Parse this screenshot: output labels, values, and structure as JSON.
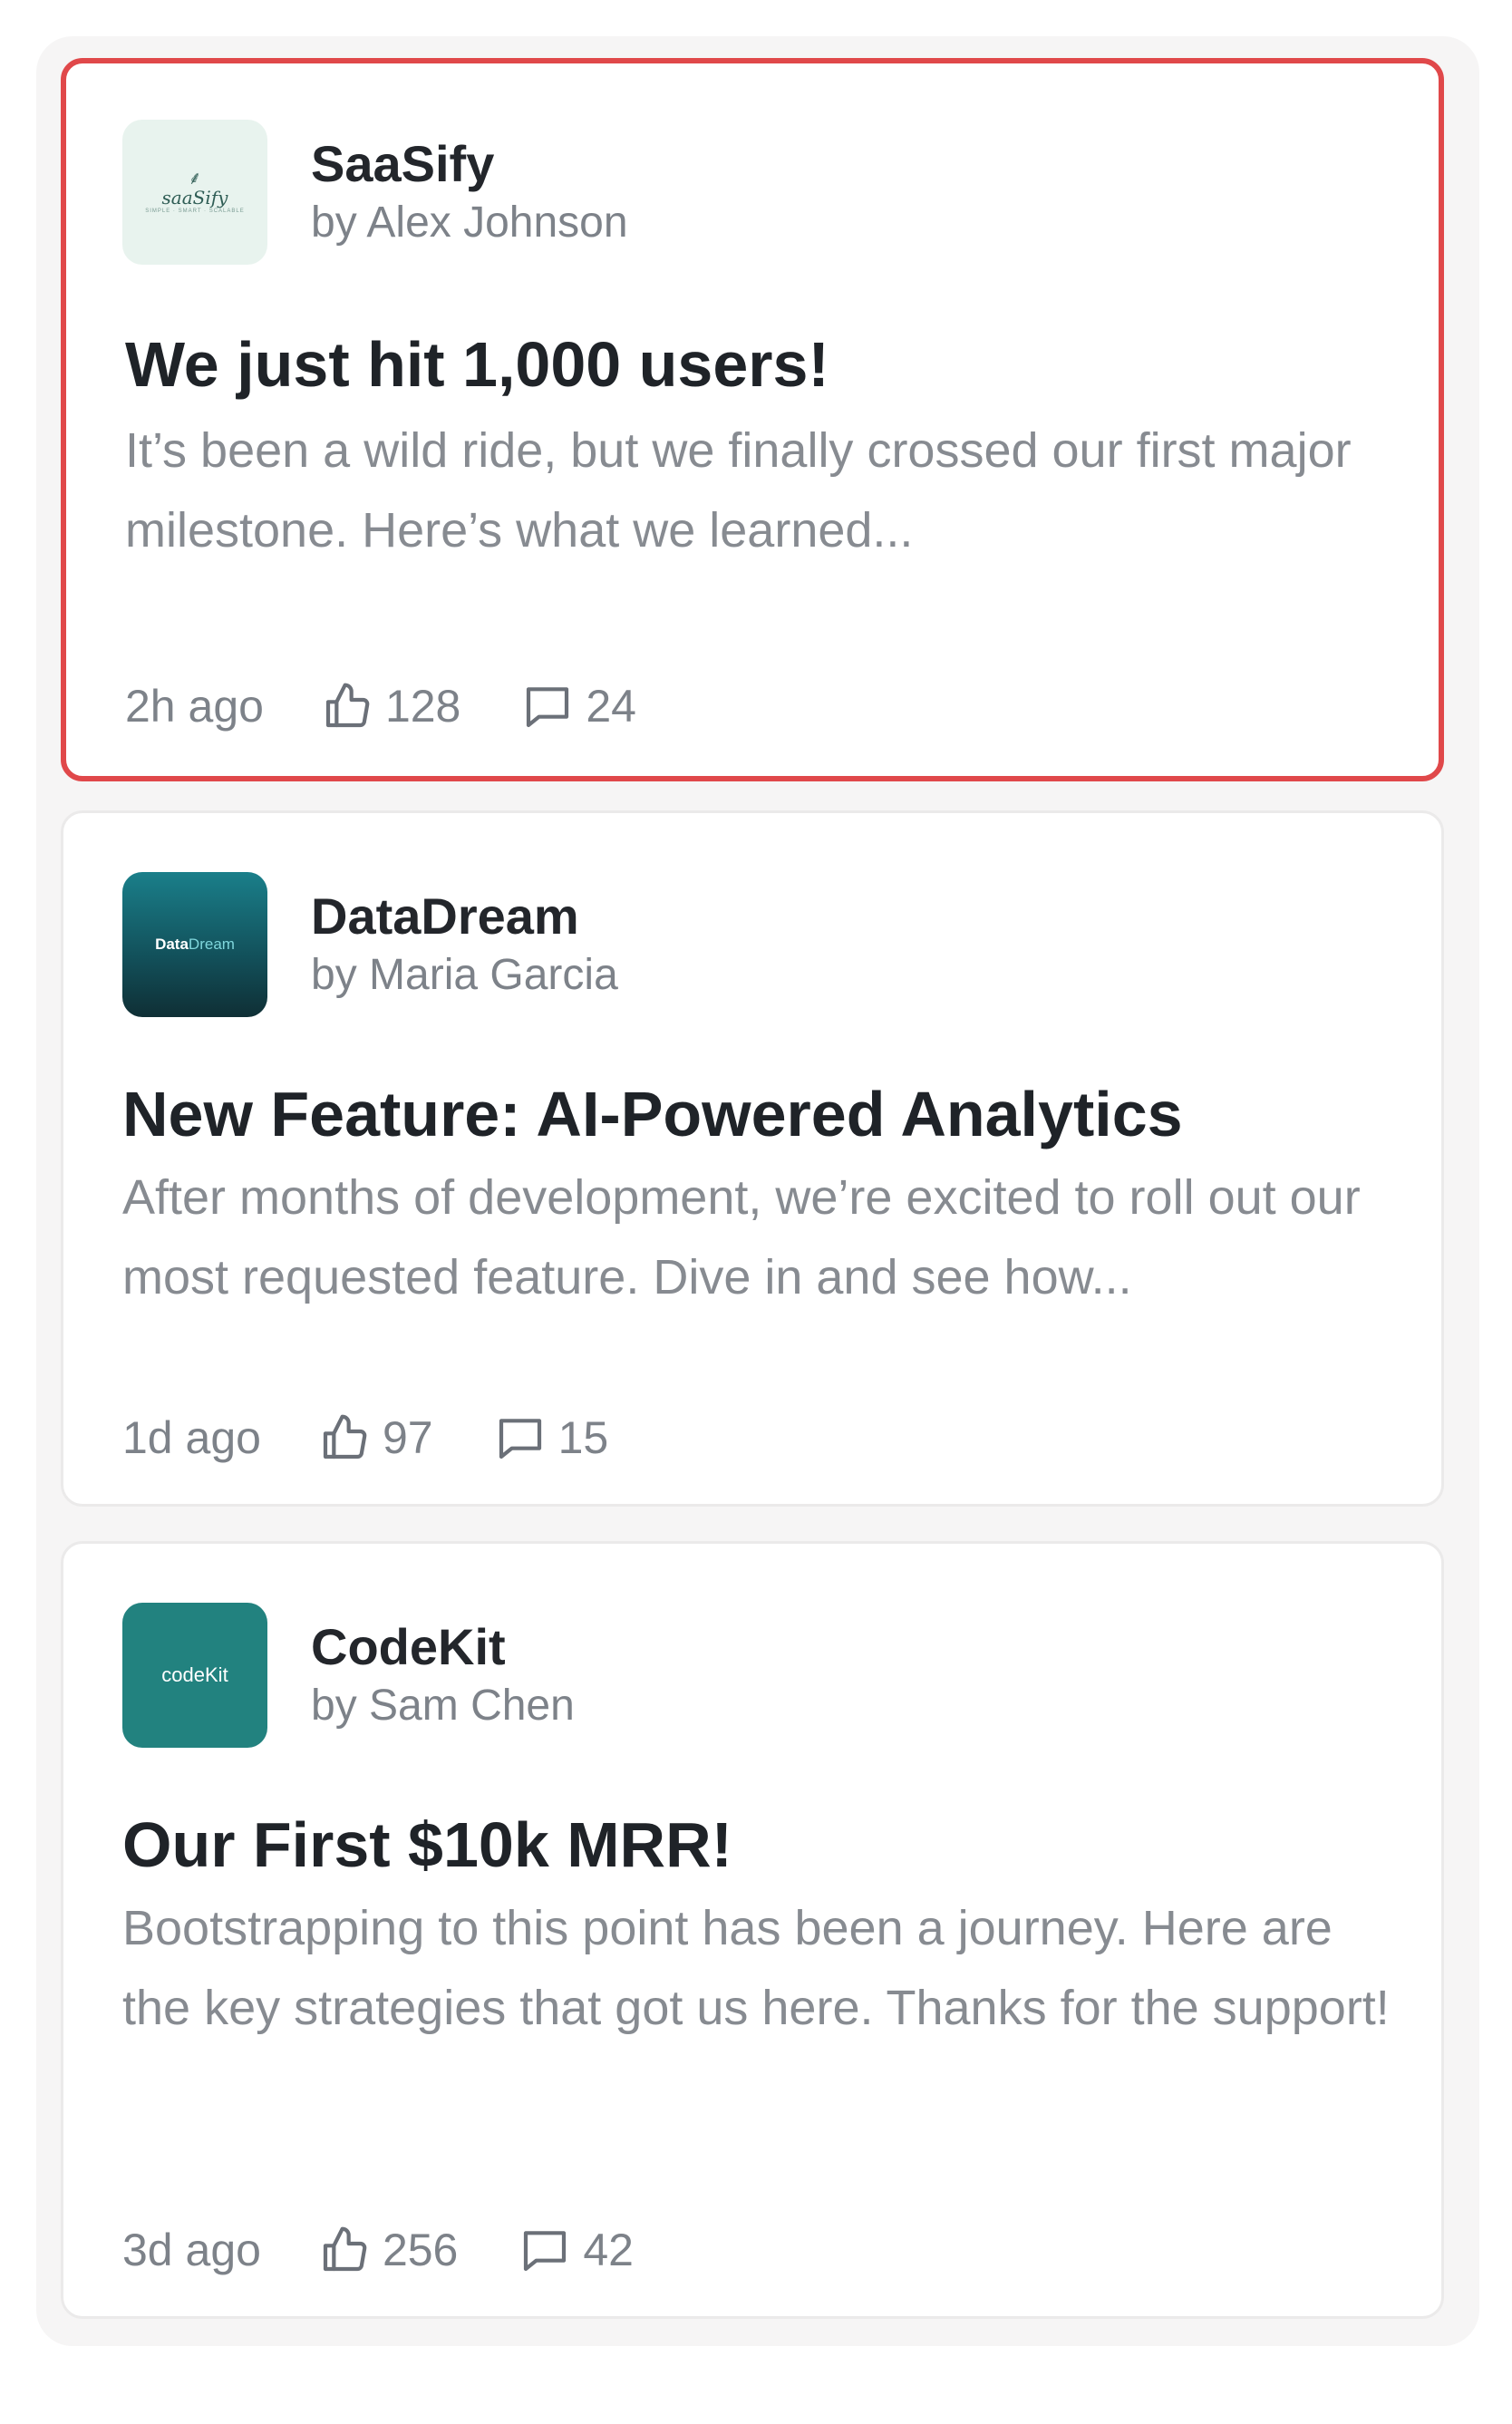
{
  "posts": [
    {
      "company": "SaaSify",
      "author": "by Alex Johnson",
      "logo": {
        "text": "saaSify",
        "tagline": "SIMPLE · SMART · SCALABLE",
        "bg": "#e8f3ee"
      },
      "title": "We just hit 1,000 users!",
      "excerpt": "It’s been a wild ride, but we finally crossed our first major milestone. Here’s what we learned...",
      "time": "2h ago",
      "likes": "128",
      "comments": "24",
      "selected": true
    },
    {
      "company": "DataDream",
      "author": "by Maria Garcia",
      "logo": {
        "text_part1": "Data",
        "text_part2": "Dream"
      },
      "title": "New Feature: AI-Powered Analytics",
      "excerpt": "After months of development, we’re excited to roll out our most requested feature. Dive in and see how...",
      "time": "1d ago",
      "likes": "97",
      "comments": "15",
      "selected": false
    },
    {
      "company": "CodeKit",
      "author": "by Sam Chen",
      "logo": {
        "text": "codeKit",
        "bg": "#22827f"
      },
      "title": "Our First $10k MRR!",
      "excerpt": "Bootstrapping to this point has been a journey. Here are the key strategies that got us here. Thanks for the support!",
      "time": "3d ago",
      "likes": "256",
      "comments": "42",
      "selected": false
    }
  ],
  "icons": {
    "like": "thumbs-up-icon",
    "comment": "comment-icon"
  },
  "colors": {
    "selected_border": "#e0484a",
    "panel_bg": "#f6f5f5",
    "muted_text": "#7d8289"
  }
}
